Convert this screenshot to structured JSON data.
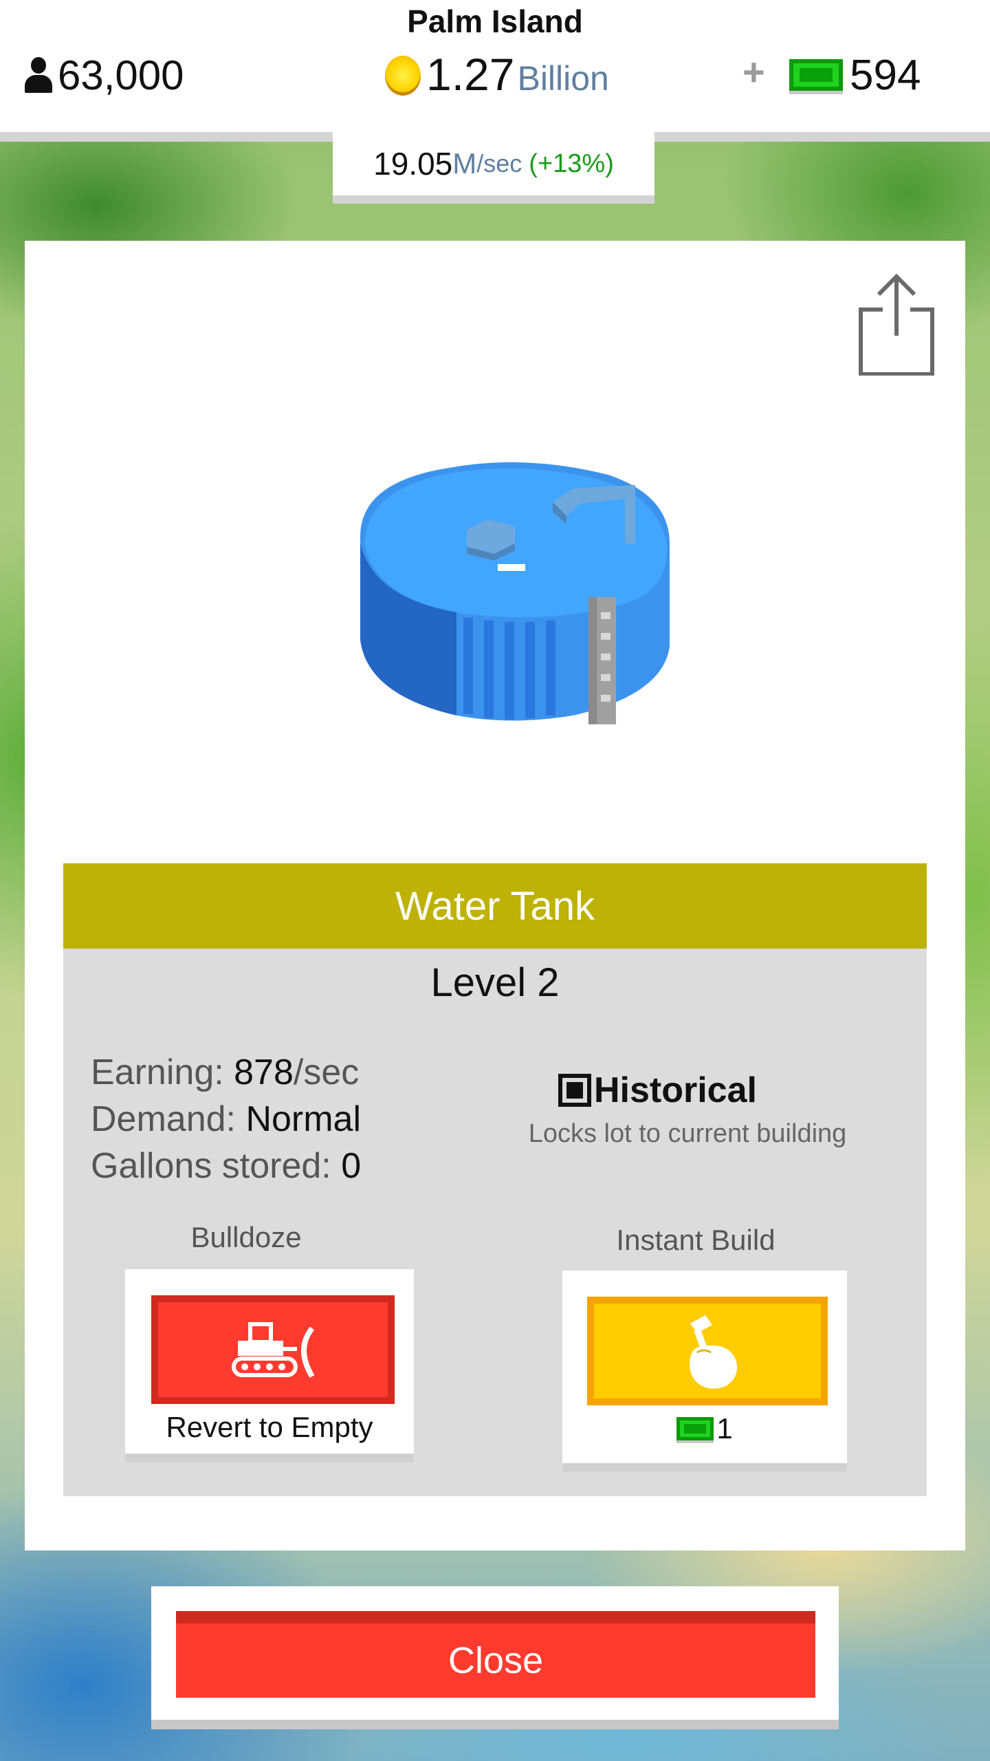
{
  "hud": {
    "island_name": "Palm Island",
    "population": "63,000",
    "money_value": "1.27",
    "money_unit": "Billion",
    "plus": "+",
    "cash": "594",
    "rate_value": "19.05",
    "rate_unit": "M",
    "rate_per": "/sec",
    "rate_bonus": "(+13%)"
  },
  "building": {
    "name": "Water Tank",
    "level": "Level 2",
    "stats": [
      {
        "label": "Earning: ",
        "value": "878",
        "suffix": "/sec"
      },
      {
        "label": "Demand: ",
        "value": "Normal",
        "suffix": ""
      },
      {
        "label": "Gallons stored: ",
        "value": "0",
        "suffix": ""
      }
    ],
    "historical_label": "Historical",
    "historical_desc": "Locks lot to current building",
    "historical_checked": true
  },
  "actions": {
    "bulldoze_label": "Bulldoze",
    "bulldoze_caption": "Revert to Empty",
    "instant_label": "Instant Build",
    "instant_cost": "1"
  },
  "close_label": "Close",
  "icons": {
    "population": "person-icon",
    "money": "coin-icon",
    "cash": "cash-icon",
    "share": "share-icon",
    "bulldozer": "bulldozer-icon",
    "hammer": "hammer-hand-icon"
  },
  "colors": {
    "title_bar": "#bdb205",
    "bulldoze": "#ff3b2f",
    "instant_build": "#ffcc00",
    "close": "#ff3b2f",
    "cash": "#1fd21f"
  }
}
